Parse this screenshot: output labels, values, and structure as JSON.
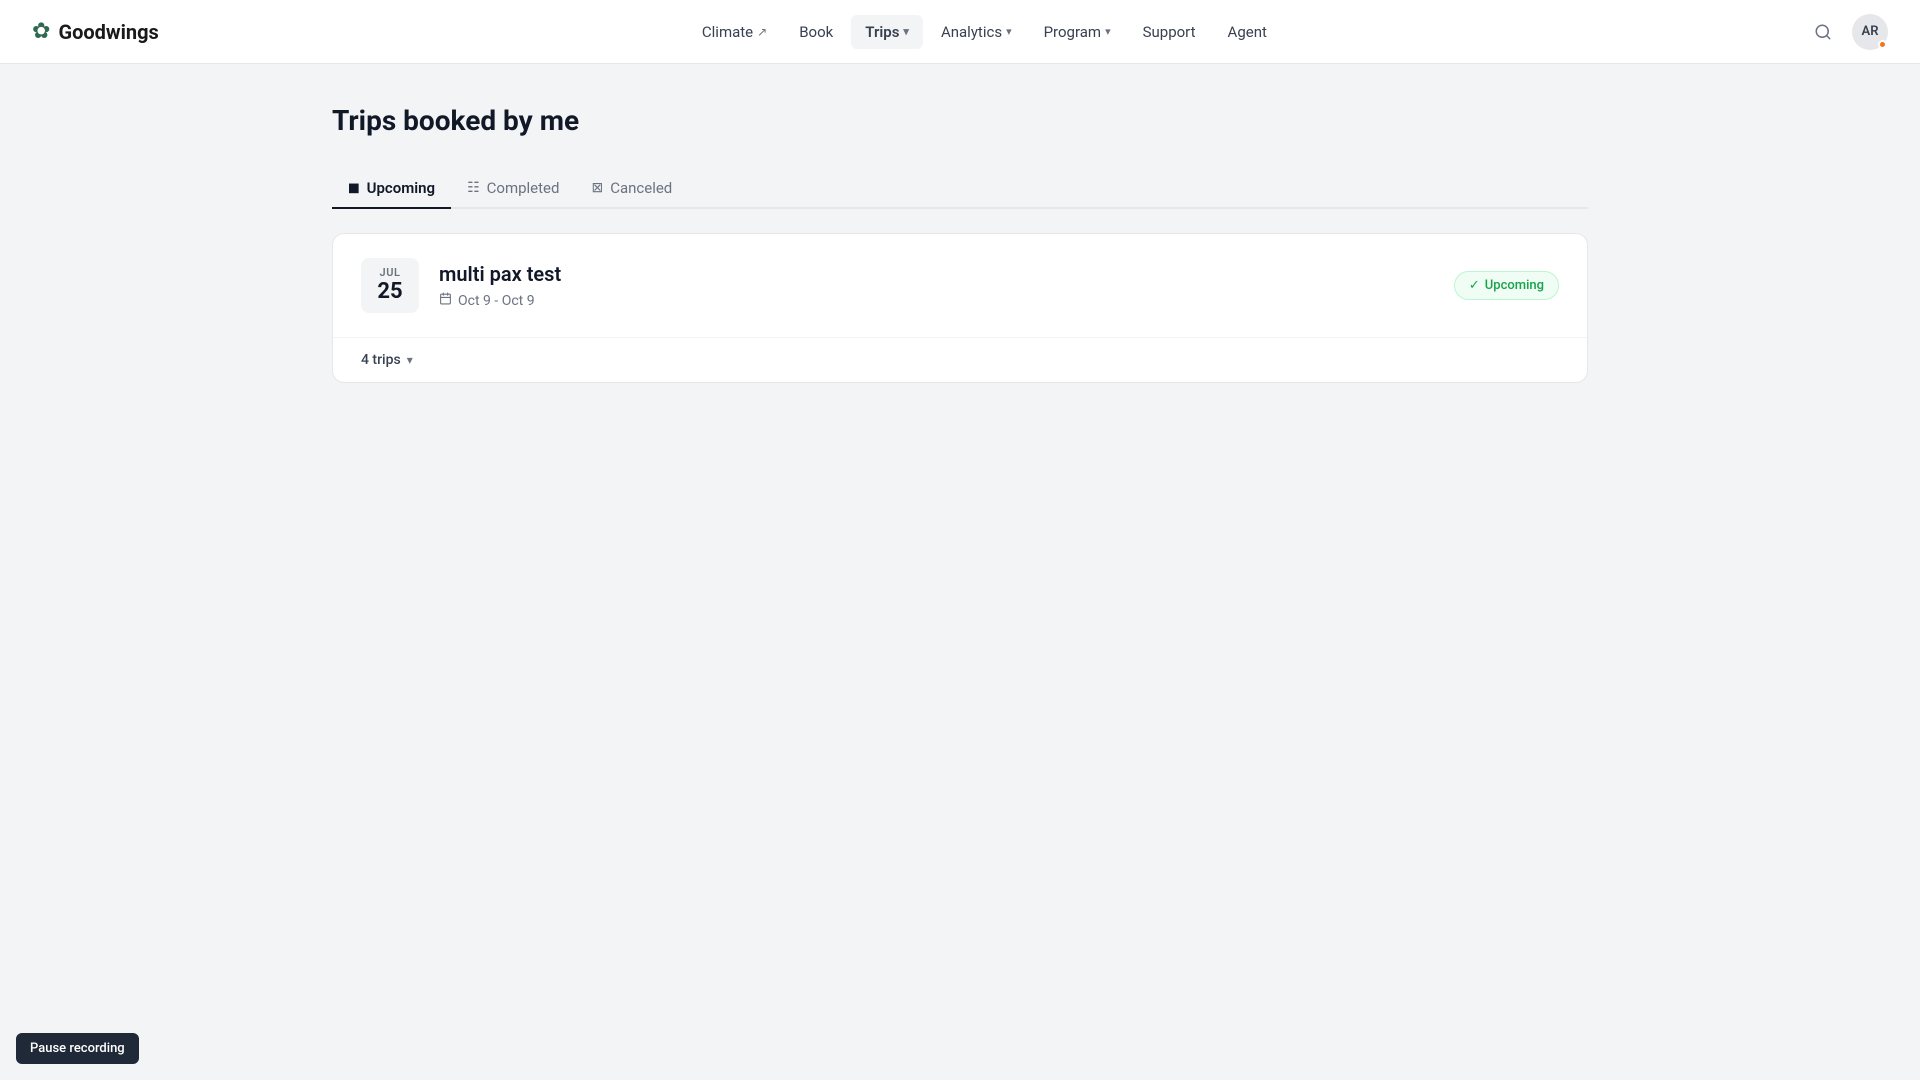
{
  "brand": {
    "logo_icon": "✿",
    "name": "Goodwings"
  },
  "nav": {
    "items": [
      {
        "id": "climate",
        "label": "Climate",
        "has_ext": true,
        "has_chevron": false
      },
      {
        "id": "book",
        "label": "Book",
        "has_ext": false,
        "has_chevron": false
      },
      {
        "id": "trips",
        "label": "Trips",
        "has_ext": false,
        "has_chevron": true,
        "active": true
      },
      {
        "id": "analytics",
        "label": "Analytics",
        "has_ext": false,
        "has_chevron": true
      },
      {
        "id": "program",
        "label": "Program",
        "has_ext": false,
        "has_chevron": true
      },
      {
        "id": "support",
        "label": "Support",
        "has_ext": false,
        "has_chevron": false
      },
      {
        "id": "agent",
        "label": "Agent",
        "has_ext": false,
        "has_chevron": false
      }
    ],
    "avatar_initials": "AR"
  },
  "page": {
    "title": "Trips booked by me"
  },
  "tabs": [
    {
      "id": "upcoming",
      "label": "Upcoming",
      "icon": "◼",
      "active": true
    },
    {
      "id": "completed",
      "label": "Completed",
      "icon": "☷",
      "active": false
    },
    {
      "id": "canceled",
      "label": "Canceled",
      "icon": "⊠",
      "active": false
    }
  ],
  "trips": [
    {
      "id": "trip-1",
      "date_month": "JUL",
      "date_day": "25",
      "name": "multi pax test",
      "date_range": "Oct 9 - Oct 9",
      "status": "Upcoming",
      "trips_count": "4 trips"
    }
  ],
  "footer": {
    "pause_recording": "Pause recording"
  }
}
